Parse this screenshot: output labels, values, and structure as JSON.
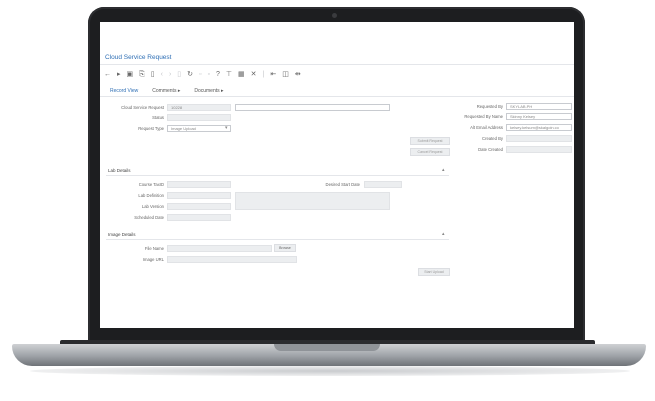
{
  "app": {
    "title": "Cloud Service Request"
  },
  "toolbar": {
    "icons": [
      "back-icon",
      "forward-icon",
      "save-icon",
      "copy-icon",
      "delete-icon",
      "undo-icon",
      "redo-icon",
      "refresh-icon",
      "help-icon",
      "filter-icon",
      "print-icon",
      "close-icon"
    ]
  },
  "tabs": [
    {
      "label": "Record View"
    },
    {
      "label": "Comments  ▸"
    },
    {
      "label": "Documents  ▸"
    }
  ],
  "form": {
    "cloud_service_request_label": "Cloud Service Request",
    "cloud_service_request_value": "10228",
    "status_label": "Status",
    "request_type_label": "Request Type",
    "request_type_value": "Image Upload",
    "requested_by_label": "Requested By",
    "requested_by_value": "SKYLAB.PH",
    "requested_by_name_label": "Requested By Name",
    "requested_by_name_value": "Skinny Kelsey",
    "alt_email_label": "Alt Email Address",
    "alt_email_value": "kelsey.kelsum@skalgoin.co",
    "created_by_label": "Created By",
    "date_created_label": "Date Created",
    "submit_button": "Submit Request",
    "cancel_button": "Cancel Request"
  },
  "lab_details": {
    "title": "Lab Details",
    "course_taxid_label": "Course TaxID",
    "lab_definition_label": "Lab Definition",
    "lab_version_label": "Lab Version",
    "scheduled_date_label": "Scheduled Date",
    "desired_start_date_label": "Desired Start Date"
  },
  "image_details": {
    "title": "Image Details",
    "file_name_label": "File Name",
    "image_url_label": "Image URL",
    "browse_button": "Browse",
    "start_upload_button": "Start Upload"
  }
}
